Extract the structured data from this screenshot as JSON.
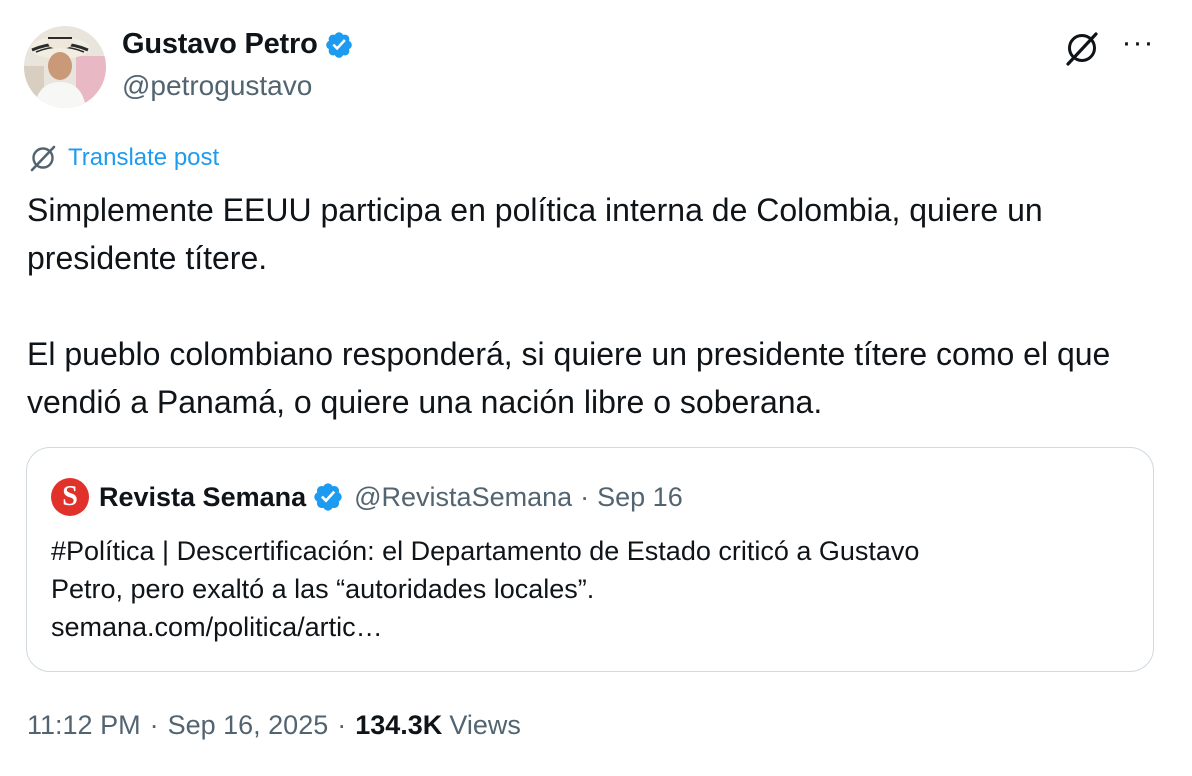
{
  "author": {
    "display_name": "Gustavo Petro",
    "handle": "@petrogustavo",
    "verified": true
  },
  "actions": {
    "grok_icon": "grok-icon",
    "more_label": "···"
  },
  "translate": {
    "label": "Translate post"
  },
  "post": {
    "paragraph1": "Simplemente EEUU participa en política interna de Colombia, quiere un presidente títere.",
    "paragraph2": "El pueblo colombiano responderá, si quiere un presidente títere como el que vendió a Panamá, o quiere una nación libre o soberana."
  },
  "quote": {
    "logo_letter": "S",
    "display_name": "Revista Semana",
    "handle": "@RevistaSemana",
    "separator": "·",
    "date": "Sep 16",
    "text_line1": "#Política | Descertificación: el Departamento de Estado criticó a Gustavo",
    "text_line2": "Petro, pero exaltó a las “autoridades locales”.",
    "link": "semana.com/politica/artic…"
  },
  "meta": {
    "time": "11:12 PM",
    "separator": "·",
    "date": "Sep 16, 2025",
    "views_count": "134.3K",
    "views_label": "Views"
  },
  "colors": {
    "text": "#0f1419",
    "secondary": "#536471",
    "link": "#1d9bf0",
    "verified": "#1d9bf0",
    "border": "#cfd9de",
    "semana_red": "#e0322b"
  }
}
